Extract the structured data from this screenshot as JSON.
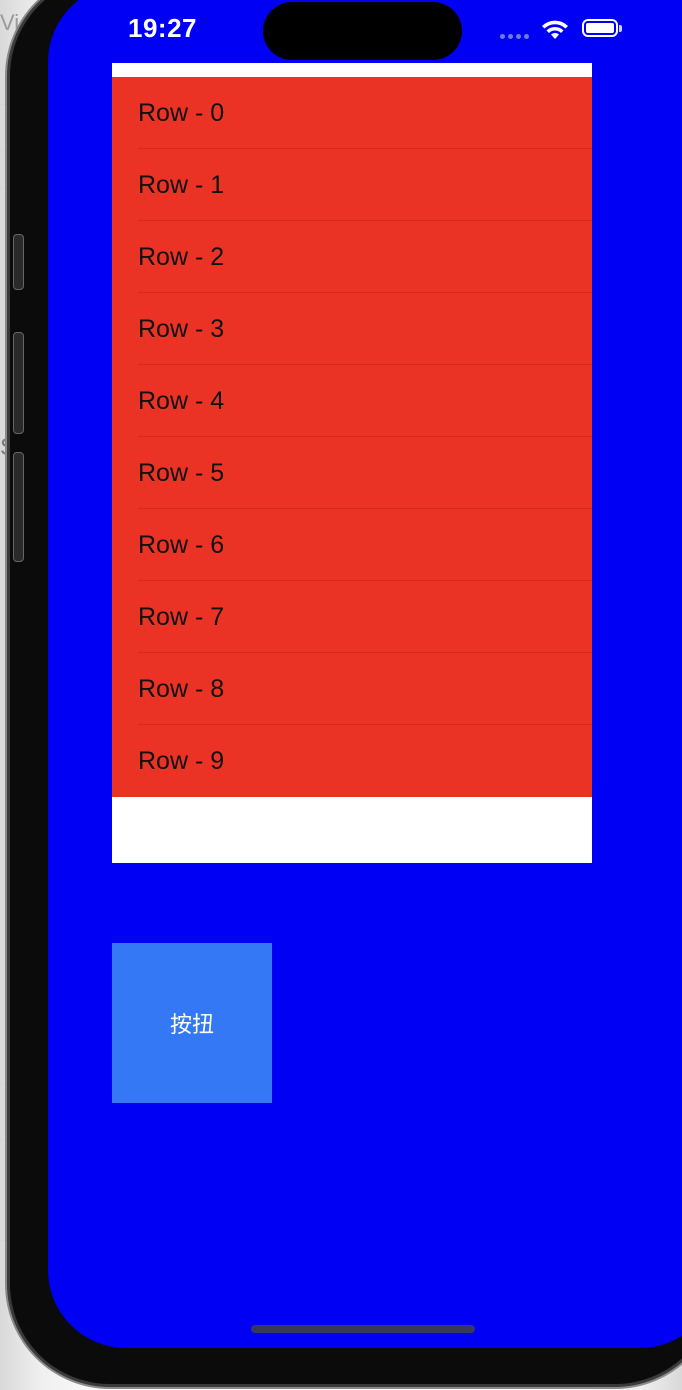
{
  "host": {
    "tab_fragment": "Vie",
    "left_glyph": "S"
  },
  "status_bar": {
    "time": "19:27",
    "wifi_icon": "wifi-icon",
    "battery_icon": "battery-icon",
    "signal_icon": "cellular-dots-icon"
  },
  "table": {
    "rows": [
      "Row - 0",
      "Row - 1",
      "Row - 2",
      "Row - 3",
      "Row - 4",
      "Row - 5",
      "Row - 6",
      "Row - 7",
      "Row - 8",
      "Row - 9"
    ]
  },
  "button": {
    "label": "按扭"
  },
  "colors": {
    "screen_background": "#0000f5",
    "table_background": "#ffffff",
    "row_background": "#ea3324",
    "button_background": "#3478f6",
    "button_text": "#ffffff"
  }
}
